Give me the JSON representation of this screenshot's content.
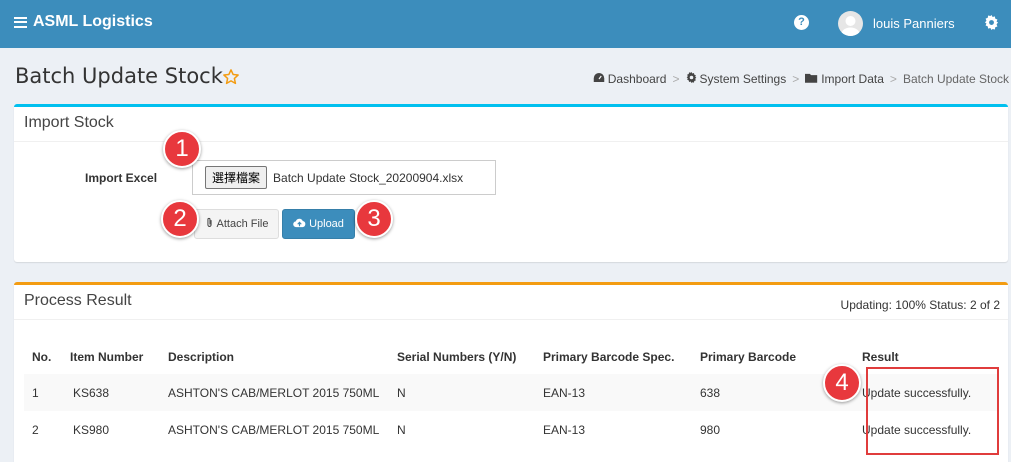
{
  "app": {
    "title": "ASML Logistics"
  },
  "user": {
    "name": "louis Panniers"
  },
  "page": {
    "title": "Batch Update Stock"
  },
  "breadcrumb": [
    {
      "label": "Dashboard",
      "icon": "dashboard-icon"
    },
    {
      "label": "System Settings",
      "icon": "gear-icon"
    },
    {
      "label": "Import Data",
      "icon": "folder-icon"
    },
    {
      "label": "Batch Update Stock"
    }
  ],
  "import_box": {
    "title": "Import Stock",
    "label": "Import Excel",
    "choose_label": "選擇檔案",
    "file_name": "Batch Update Stock_20200904.xlsx",
    "attach_label": "Attach File",
    "upload_label": "Upload"
  },
  "result_box": {
    "title": "Process Result",
    "status": "Updating: 100% Status: 2 of 2",
    "columns": [
      "No.",
      "Item Number",
      "Description",
      "Serial Numbers (Y/N)",
      "Primary Barcode Spec.",
      "Primary Barcode",
      "Result"
    ],
    "rows": [
      [
        "1",
        "KS638",
        "ASHTON'S CAB/MERLOT 2015 750ML",
        "N",
        "EAN-13",
        "638",
        "Update successfully."
      ],
      [
        "2",
        "KS980",
        "ASHTON'S CAB/MERLOT 2015 750ML",
        "N",
        "EAN-13",
        "980",
        "Update successfully."
      ]
    ]
  },
  "annotations": [
    "1",
    "2",
    "3",
    "4"
  ],
  "colors": {
    "header": "#3c8dbc",
    "import_accent": "#00c0ef",
    "result_accent": "#f39c12",
    "badge": "#e8383d"
  }
}
